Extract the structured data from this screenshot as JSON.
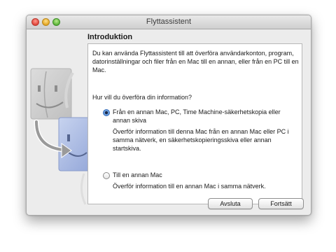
{
  "window": {
    "title": "Flyttassistent"
  },
  "section": {
    "heading": "Introduktion"
  },
  "content": {
    "intro": "Du kan använda Flyttassistent till att överföra användarkonton, program, datorinställningar och filer från en Mac till en annan, eller från en PC till en Mac.",
    "question": "Hur vill du överföra din information?",
    "options": [
      {
        "label": "Från en annan Mac, PC, Time Machine-säkerhetskopia eller annan skiva",
        "description": "Överför information till denna Mac från en annan Mac eller PC i samma nätverk, en säkerhetskopieringsskiva eller annan startskiva.",
        "selected": true
      },
      {
        "label": "Till en annan Mac",
        "description": "Överför information till en annan Mac i samma nätverk.",
        "selected": false
      }
    ]
  },
  "buttons": {
    "quit": "Avsluta",
    "continue": "Fortsätt"
  },
  "icons": {
    "window_controls": [
      "close-icon",
      "minimize-icon",
      "zoom-icon"
    ],
    "illustration": "migration-finder-icon"
  },
  "colors": {
    "window_background": "#ececec",
    "panel_background": "#ffffff",
    "radio_accent": "#3c7fd6"
  }
}
